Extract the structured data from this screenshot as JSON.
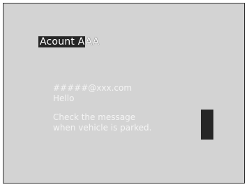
{
  "account": {
    "name_highlighted": "Acount A",
    "name_rest": "AA"
  },
  "message": {
    "sender": "#####@xxx.com",
    "greeting": "Hello",
    "notice_line1": "Check the message",
    "notice_line2": "when vehicle is parked."
  },
  "colors": {
    "background": "#d3d3d3",
    "highlight": "#262626",
    "text": "#ffffff"
  }
}
